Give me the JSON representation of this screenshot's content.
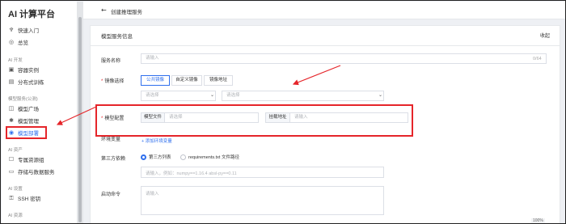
{
  "app": {
    "title": "AI 计算平台"
  },
  "sidebar": {
    "quick_start": "快速入门",
    "overview": "总览",
    "sections": [
      {
        "title": "AI 开发",
        "items": [
          {
            "label": "容器实例"
          },
          {
            "label": "分布式训练"
          }
        ]
      },
      {
        "title": "模型服务(公测)",
        "items": [
          {
            "label": "模型广场"
          },
          {
            "label": "模型管理"
          },
          {
            "label": "模型部署"
          }
        ]
      },
      {
        "title": "AI 资产",
        "items": [
          {
            "label": "专属资源组"
          },
          {
            "label": "存储与数据服务"
          }
        ]
      },
      {
        "title": "AI 设置",
        "items": [
          {
            "label": "SSH 密钥"
          }
        ]
      },
      {
        "title": "AI 资源",
        "items": []
      }
    ],
    "active_item": "模型部署"
  },
  "header": {
    "back_label": "←",
    "title": "创建推理服务"
  },
  "card": {
    "title": "模型服务信息",
    "collapse_label": "收起"
  },
  "form": {
    "service_name": {
      "label": "服务名称",
      "placeholder": "请输入",
      "counter": "0/64"
    },
    "image": {
      "label": "镜像选择",
      "tabs": [
        "公共镜像",
        "自定义镜像",
        "镜像地址"
      ],
      "active_tab": "公共镜像",
      "select1_placeholder": "请选择",
      "select2_placeholder": "请选择"
    },
    "model_config": {
      "label": "模型配置",
      "model_file_label": "模型文件",
      "model_file_placeholder": "请选择",
      "mount_label": "挂载地址",
      "mount_placeholder": "请输入"
    },
    "env_vars": {
      "label": "环境变量",
      "add_link": "+ 添加环境变量"
    },
    "third_party": {
      "label": "第三方依赖",
      "options": [
        "第三方列表",
        "requirements.txt 文件路径"
      ],
      "selected": "第三方列表",
      "placeholder": "请输入，例如：numpy==1.16.4 absl-py==0.11"
    },
    "startup": {
      "label": "启动命令",
      "placeholder": "请输入"
    }
  },
  "zoom": "100%",
  "colors": {
    "accent": "#2f6fed",
    "highlight": "#e5252a"
  }
}
